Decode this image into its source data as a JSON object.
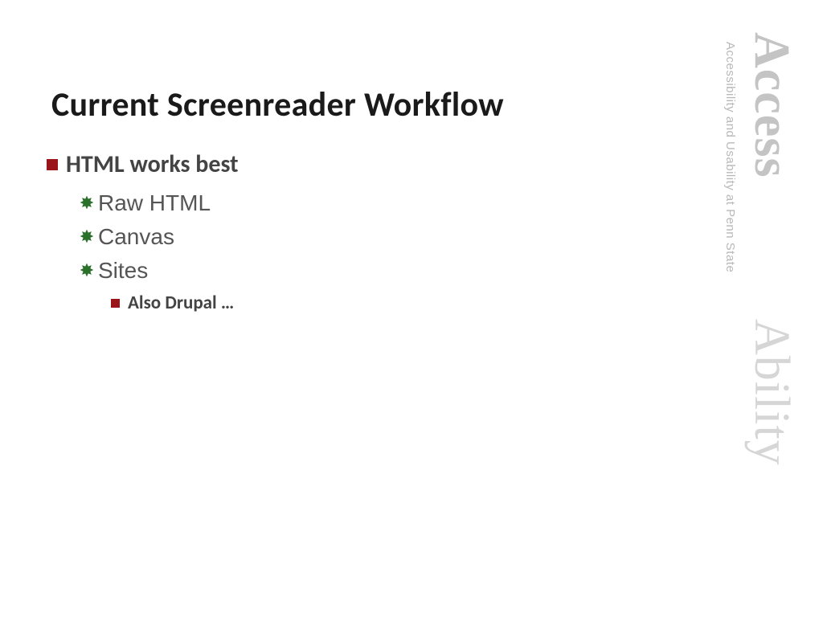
{
  "slide": {
    "title": "Current Screenreader Workflow",
    "b1": "HTML works best",
    "b2a": "Raw HTML",
    "b2b": "Canvas",
    "b2c": "Sites",
    "b3": "Also Drupal …"
  },
  "sidebar": {
    "tagline": "Accessibility and Usability at Penn State",
    "word1": "Access",
    "word2": "Ability"
  }
}
